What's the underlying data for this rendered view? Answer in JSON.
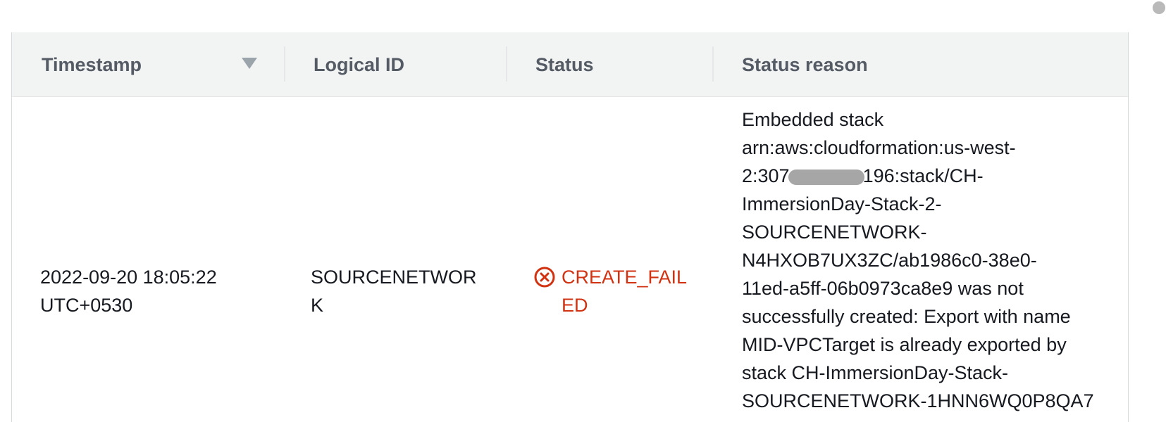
{
  "table": {
    "columns": {
      "timestamp": "Timestamp",
      "logical_id": "Logical ID",
      "status": "Status",
      "status_reason": "Status reason"
    },
    "sort_icon": "caret-down-icon",
    "row": {
      "timestamp_lines": [
        "2022-09-20 18:05:22",
        "UTC+0530"
      ],
      "logical_id_lines": [
        "SOURCENETWOR",
        "K"
      ],
      "status_icon": "error-circle-x-icon",
      "status_color": "#d13212",
      "status_lines": [
        "CREATE_FAIL",
        "ED"
      ],
      "reason": {
        "line1": "Embedded stack",
        "line2": "arn:aws:cloudformation:us-west-",
        "line3_prefix": "2:307",
        "line3_suffix": "196:stack/CH-",
        "line4": "ImmersionDay-Stack-2-",
        "line5": "SOURCENETWORK-",
        "line6": "N4HXOB7UX3ZC/ab1986c0-38e0-",
        "line7": "11ed-a5ff-06b0973ca8e9 was not",
        "line8": "successfully created: Export with name",
        "line9": "MID-VPCTarget is already exported by",
        "line10": "stack CH-ImmersionDay-Stack-",
        "line11": "SOURCENETWORK-1HNN6WQ0P8QA7"
      }
    }
  }
}
